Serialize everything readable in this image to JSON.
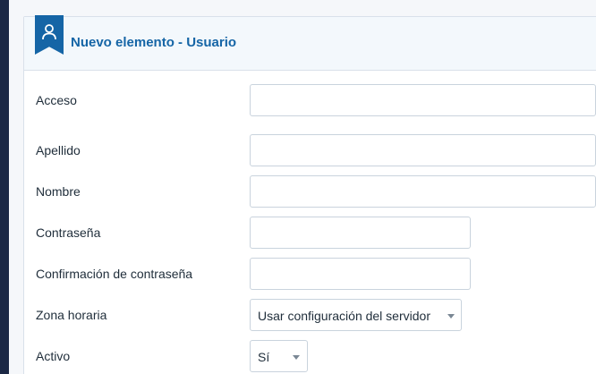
{
  "panel": {
    "title": "Nuevo elemento - Usuario",
    "icon": "user-icon"
  },
  "fields": {
    "access": {
      "label": "Acceso",
      "value": ""
    },
    "lastname": {
      "label": "Apellido",
      "value": ""
    },
    "firstname": {
      "label": "Nombre",
      "value": ""
    },
    "password": {
      "label": "Contraseña",
      "value": ""
    },
    "password_confirm": {
      "label": "Confirmación de contraseña",
      "value": ""
    },
    "timezone": {
      "label": "Zona horaria",
      "value": "Usar configuración del servidor"
    },
    "active": {
      "label": "Activo",
      "value": "Sí"
    }
  },
  "colors": {
    "accent": "#1565a6",
    "sidebar": "#1b2845",
    "header_bg": "#f3f8fc"
  }
}
